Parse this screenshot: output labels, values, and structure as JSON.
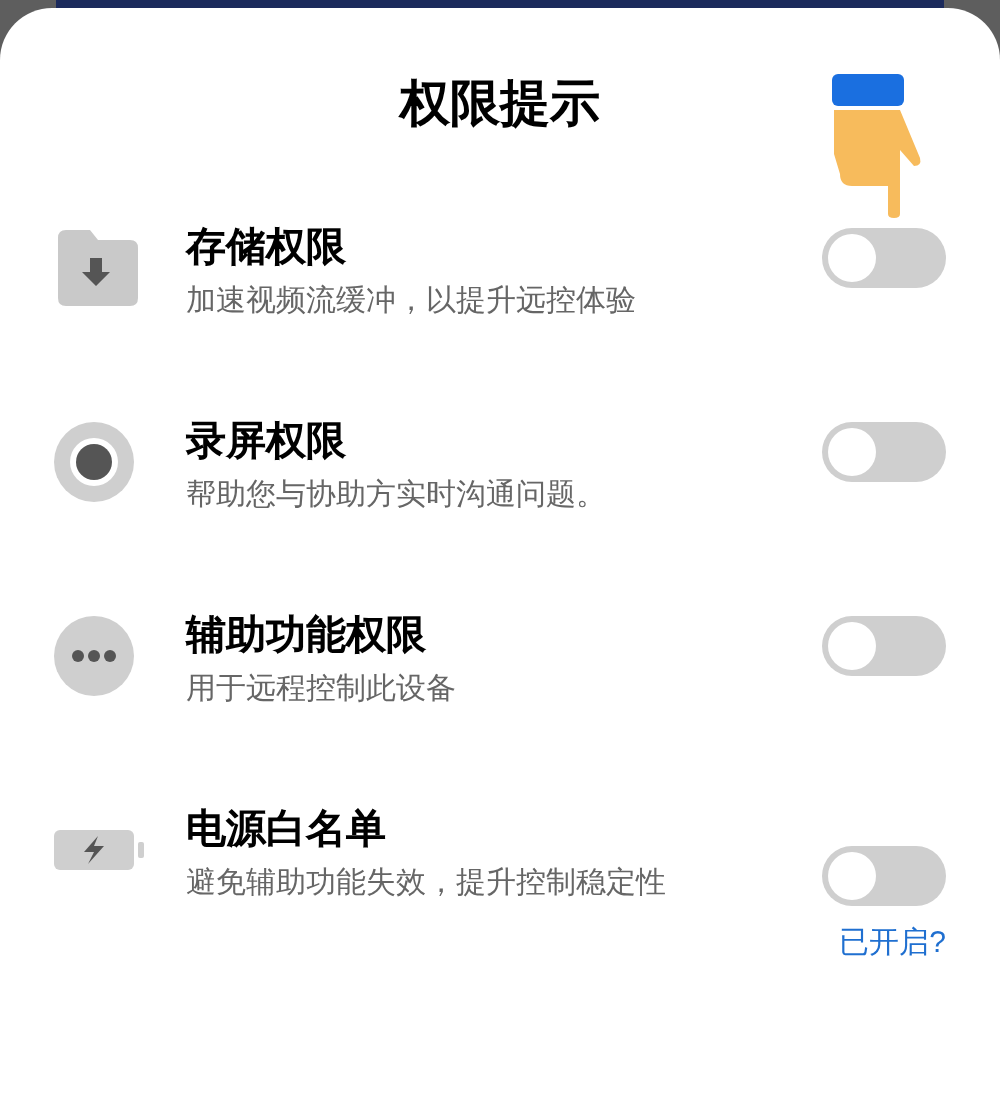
{
  "dialog": {
    "title": "权限提示"
  },
  "permissions": [
    {
      "kind": "folder",
      "name": "存储权限",
      "description": "加速视频流缓冲，以提升远控体验",
      "on": false
    },
    {
      "kind": "record",
      "name": "录屏权限",
      "description": "帮助您与协助方实时沟通问题。",
      "on": false
    },
    {
      "kind": "more",
      "name": "辅助功能权限",
      "description": "用于远程控制此设备",
      "on": false
    },
    {
      "kind": "battery",
      "name": "电源白名单",
      "description": "避免辅助功能失效，提升控制稳定性",
      "on": false,
      "link": "已开启?"
    }
  ]
}
